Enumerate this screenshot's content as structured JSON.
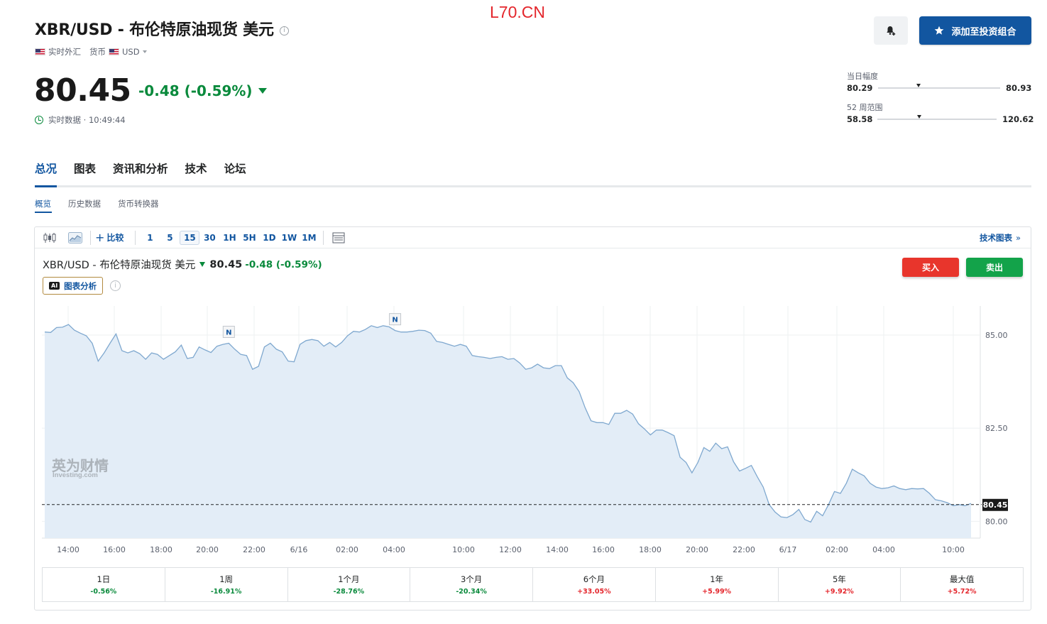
{
  "watermark_top": "L70.CN",
  "header": {
    "title": "XBR/USD - 布伦特原油现货 美元",
    "info_glyph": "i",
    "meta": {
      "market": "实时外汇",
      "type": "货币",
      "currency": "USD"
    },
    "price": "80.45",
    "change": "-0.48 (-0.59%)",
    "realtime": "实时数据 · 10:49:44",
    "add_portfolio_label": "添加至投资组合"
  },
  "ranges": {
    "day": {
      "label": "当日幅度",
      "low": "80.29",
      "high": "80.93",
      "position": 0.33
    },
    "week52": {
      "label": "52 周范围",
      "low": "58.58",
      "high": "120.62",
      "position": 0.35
    }
  },
  "tabs": [
    {
      "label": "总况",
      "active": true
    },
    {
      "label": "图表",
      "active": false
    },
    {
      "label": "资讯和分析",
      "active": false
    },
    {
      "label": "技术",
      "active": false
    },
    {
      "label": "论坛",
      "active": false
    }
  ],
  "subtabs": [
    {
      "label": "概览",
      "active": true
    },
    {
      "label": "历史数据",
      "active": false
    },
    {
      "label": "货币转换器",
      "active": false
    }
  ],
  "toolbar": {
    "compare_label": "比较",
    "intervals": [
      "1",
      "5",
      "15",
      "30",
      "1H",
      "5H",
      "1D",
      "1W",
      "1M"
    ],
    "active_interval": "15",
    "tech_chart_label": "技术图表"
  },
  "chart_header": {
    "name": "XBR/USD - 布伦特原油现货 美元",
    "price": "80.45",
    "change": "-0.48 (-0.59%)",
    "ai_badge": "AI",
    "ai_label": "图表分析",
    "info_glyph": "i",
    "buy_label": "买入",
    "sell_label": "卖出"
  },
  "chart_watermark": {
    "cn": "英为财情",
    "en": "Investing.com"
  },
  "chart_data": {
    "type": "area",
    "x_tick_labels": [
      "14:00",
      "16:00",
      "18:00",
      "20:00",
      "22:00",
      "6/16",
      "02:00",
      "04:00",
      "10:00",
      "12:00",
      "14:00",
      "16:00",
      "18:00",
      "20:00",
      "22:00",
      "6/17",
      "02:00",
      "04:00",
      "10:00"
    ],
    "y_tick_labels": [
      "85.00",
      "82.50",
      "80.00"
    ],
    "y_ticks": [
      85.0,
      82.5,
      80.0
    ],
    "ylim": [
      79.55,
      85.78
    ],
    "current_price_label": "80.45",
    "current_price": 80.45,
    "news_markers": [
      {
        "label": "N",
        "index": 31
      },
      {
        "label": "N",
        "index": 59
      }
    ],
    "series": [
      {
        "values": [
          85.08,
          85.07,
          85.2,
          85.21,
          85.28,
          85.13,
          85.05,
          84.98,
          84.78,
          84.3,
          84.52,
          84.78,
          85.03,
          84.58,
          84.52,
          84.58,
          84.5,
          84.35,
          84.52,
          84.48,
          84.35,
          84.45,
          84.55,
          84.73,
          84.37,
          84.4,
          84.68,
          84.6,
          84.53,
          84.7,
          84.75,
          84.78,
          84.62,
          84.48,
          84.45,
          84.08,
          84.16,
          84.68,
          84.78,
          84.62,
          84.55,
          84.3,
          84.28,
          84.75,
          84.85,
          84.88,
          84.85,
          84.7,
          84.8,
          84.68,
          84.8,
          84.98,
          85.1,
          85.08,
          85.15,
          85.25,
          85.2,
          85.25,
          85.22,
          85.12,
          85.08,
          85.08,
          85.1,
          85.13,
          85.12,
          85.05,
          84.83,
          84.8,
          84.75,
          84.7,
          84.75,
          84.7,
          84.45,
          84.42,
          84.4,
          84.37,
          84.4,
          84.42,
          84.35,
          84.37,
          84.25,
          84.08,
          84.12,
          84.22,
          84.12,
          84.1,
          84.18,
          84.18,
          83.85,
          83.72,
          83.48,
          83.05,
          82.7,
          82.65,
          82.65,
          82.6,
          82.9,
          82.9,
          82.98,
          82.88,
          82.62,
          82.48,
          82.32,
          82.45,
          82.45,
          82.38,
          82.3,
          81.72,
          81.58,
          81.3,
          81.58,
          81.98,
          81.88,
          82.1,
          81.95,
          82.0,
          81.6,
          81.35,
          81.42,
          81.5,
          81.2,
          80.92,
          80.45,
          80.25,
          80.12,
          80.1,
          80.18,
          80.32,
          80.05,
          79.98,
          80.27,
          80.15,
          80.45,
          80.8,
          80.75,
          81.02,
          81.4,
          81.3,
          81.22,
          81.02,
          80.92,
          80.88,
          80.9,
          80.95,
          80.88,
          80.85,
          80.88,
          80.87,
          80.88,
          80.75,
          80.58,
          80.55,
          80.5,
          80.42,
          80.45,
          80.42,
          80.48
        ]
      }
    ],
    "area_color": "#e3edf7",
    "line_color": "#7fa8cf",
    "grid": true
  },
  "performance": [
    {
      "label": "1日",
      "value": "-0.56%",
      "sign": "neg"
    },
    {
      "label": "1周",
      "value": "-16.91%",
      "sign": "neg"
    },
    {
      "label": "1个月",
      "value": "-28.76%",
      "sign": "neg"
    },
    {
      "label": "3个月",
      "value": "-20.34%",
      "sign": "neg"
    },
    {
      "label": "6个月",
      "value": "+33.05%",
      "sign": "pos"
    },
    {
      "label": "1年",
      "value": "+5.99%",
      "sign": "pos"
    },
    {
      "label": "5年",
      "value": "+9.92%",
      "sign": "pos"
    },
    {
      "label": "最大值",
      "value": "+5.72%",
      "sign": "pos"
    }
  ],
  "colors": {
    "brand": "#1256a0",
    "negative": "#0a8a3c",
    "positive": "#e4262c",
    "buy": "#e8352c",
    "sell": "#13a34a"
  }
}
